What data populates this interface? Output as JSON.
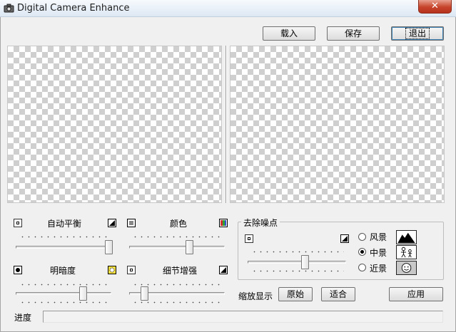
{
  "window": {
    "title": "Digital Camera Enhance",
    "close_glyph": "✕"
  },
  "toolbar": {
    "load_label": "载入",
    "save_label": "保存",
    "exit_label": "退出"
  },
  "adjust": {
    "auto_balance": {
      "label": "自动平衡",
      "level": 1.0
    },
    "color": {
      "label": "颜色",
      "level": 0.72
    },
    "brightness": {
      "label": "明暗度",
      "level": 0.72
    },
    "detail": {
      "label": "细节增强",
      "level": 0.13
    }
  },
  "denoise": {
    "title": "去除噪点",
    "level": 0.6,
    "modes": [
      {
        "label": "风景",
        "selected": false,
        "icon": "landscape-icon"
      },
      {
        "label": "中景",
        "selected": true,
        "icon": "people-icon"
      },
      {
        "label": "近景",
        "selected": false,
        "icon": "face-icon"
      }
    ]
  },
  "zoom": {
    "label": "缩放显示",
    "original_label": "原始",
    "fit_label": "适合"
  },
  "apply_label": "应用",
  "progress": {
    "label": "进度",
    "value": 0
  }
}
